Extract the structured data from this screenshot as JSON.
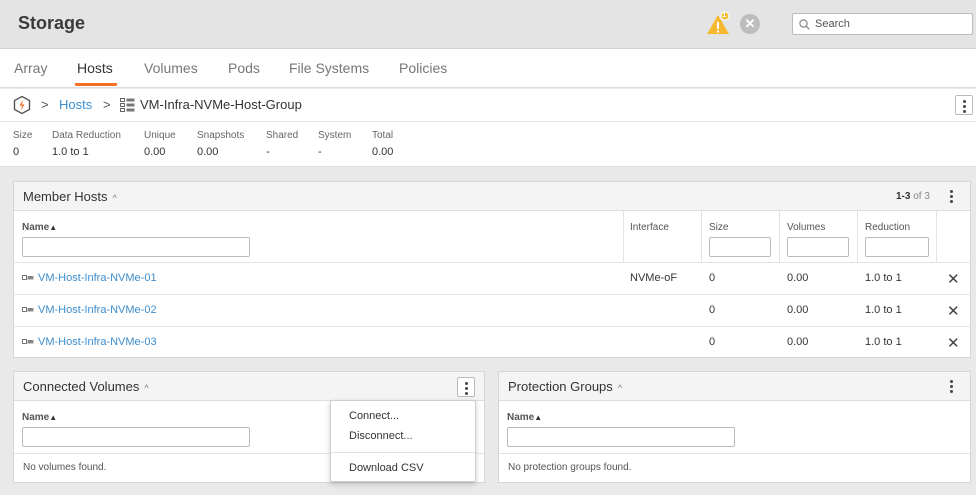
{
  "header": {
    "title": "Storage",
    "alert_count": "1",
    "search_placeholder": "Search"
  },
  "tabs": [
    {
      "label": "Array",
      "active": false
    },
    {
      "label": "Hosts",
      "active": true
    },
    {
      "label": "Volumes",
      "active": false
    },
    {
      "label": "Pods",
      "active": false
    },
    {
      "label": "File Systems",
      "active": false
    },
    {
      "label": "Policies",
      "active": false
    }
  ],
  "breadcrumb": {
    "sep": ">",
    "parent": "Hosts",
    "current": "VM-Infra-NVMe-Host-Group"
  },
  "stats": [
    {
      "label": "Size",
      "value": "0"
    },
    {
      "label": "Data Reduction",
      "value": "1.0 to 1"
    },
    {
      "label": "Unique",
      "value": "0.00"
    },
    {
      "label": "Snapshots",
      "value": "0.00"
    },
    {
      "label": "Shared",
      "value": "-"
    },
    {
      "label": "System",
      "value": "-"
    },
    {
      "label": "Total",
      "value": "0.00"
    }
  ],
  "member_hosts": {
    "title": "Member Hosts",
    "range": "1-3",
    "of_label": "of 3",
    "columns": [
      "Name",
      "Interface",
      "Size",
      "Volumes",
      "Reduction"
    ],
    "rows": [
      {
        "name": "VM-Host-Infra-NVMe-01",
        "interface": "NVMe-oF",
        "size": "0",
        "volumes": "0.00",
        "reduction": "1.0 to 1"
      },
      {
        "name": "VM-Host-Infra-NVMe-02",
        "interface": "",
        "size": "0",
        "volumes": "0.00",
        "reduction": "1.0 to 1"
      },
      {
        "name": "VM-Host-Infra-NVMe-03",
        "interface": "",
        "size": "0",
        "volumes": "0.00",
        "reduction": "1.0 to 1"
      }
    ],
    "remove_glyph": "✕"
  },
  "connected_volumes": {
    "title": "Connected Volumes",
    "name_col": "Name",
    "empty": "No volumes found."
  },
  "protection_groups": {
    "title": "Protection Groups",
    "name_col": "Name",
    "empty": "No protection groups found."
  },
  "menu": {
    "items": [
      "Connect...",
      "Disconnect...",
      "Download CSV"
    ]
  },
  "glyphs": {
    "caret_up": "^",
    "sort_asc": "▲",
    "close": "✕"
  },
  "colors": {
    "accent": "#f36f21",
    "link": "#3c8ed0",
    "warning": "#f5b82e"
  },
  "icons": [
    "warning-icon",
    "close-circle-icon",
    "search-icon",
    "purity-logo-icon",
    "host-group-icon",
    "host-icon",
    "kebab-icon"
  ]
}
